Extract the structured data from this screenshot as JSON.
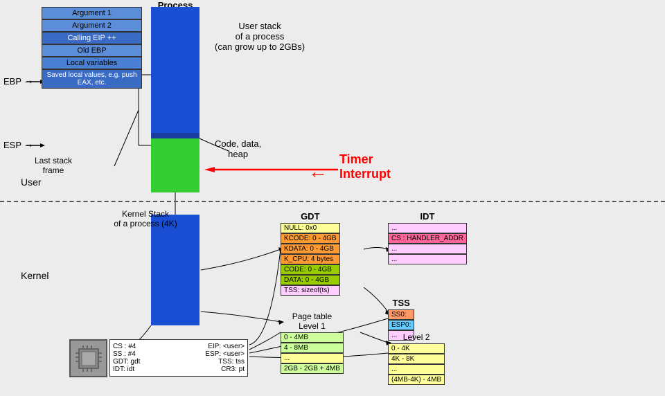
{
  "diagram": {
    "process_label": "Process",
    "user_section_label": "User",
    "kernel_section_label": "Kernel",
    "stack_items": [
      {
        "label": "Argument 1",
        "type": "normal"
      },
      {
        "label": "Argument 2",
        "type": "normal"
      },
      {
        "label": "Calling EIP ++",
        "type": "highlight"
      },
      {
        "label": "Old EBP",
        "type": "normal"
      },
      {
        "label": "Local variables",
        "type": "local"
      },
      {
        "label": "Saved local values, e.g. push EAX, etc.",
        "type": "saved"
      }
    ],
    "ebp_label": "EBP",
    "esp_label": "ESP",
    "user_stack_title": "User stack",
    "user_stack_subtitle": "of a process",
    "user_stack_capacity": "(can grow up to 2GBs)",
    "code_data_label": "Code, data,",
    "code_data_heap": "heap",
    "last_stack_label": "Last stack",
    "last_stack_frame": "frame",
    "timer_interrupt_label": "Timer",
    "timer_interrupt_label2": "Interrupt",
    "kernel_stack_title": "Kernel Stack",
    "kernel_stack_subtitle": "of a process (4K)",
    "gdt": {
      "title": "GDT",
      "rows": [
        {
          "label": "NULL: 0x0",
          "color": "#ffff99"
        },
        {
          "label": "KCODE: 0 - 4GB",
          "color": "#ff9933"
        },
        {
          "label": "KDATA: 0 - 4GB",
          "color": "#ff9933"
        },
        {
          "label": "K_CPU: 4 bytes",
          "color": "#ff9933"
        },
        {
          "label": "CODE: 0 - 4GB",
          "color": "#99cc00"
        },
        {
          "label": "DATA: 0 - 4GB",
          "color": "#99cc00"
        },
        {
          "label": "TSS: sizeof(ts)",
          "color": "#ffccff"
        }
      ]
    },
    "idt": {
      "title": "IDT",
      "rows": [
        {
          "label": "...",
          "color": "#ffccff"
        },
        {
          "label": "CS : HANDLER_ADDR",
          "color": "#ff6699"
        },
        {
          "label": "...",
          "color": "#ffccff"
        },
        {
          "label": "...",
          "color": "#ffccff"
        }
      ]
    },
    "tss": {
      "title": "TSS",
      "rows": [
        {
          "label": "SS0:",
          "color": "#ff9966"
        },
        {
          "label": "ESP0:",
          "color": "#66ccff"
        },
        {
          "label": "...",
          "color": "#ffccff"
        }
      ]
    },
    "pagetable1": {
      "title": "Page table",
      "subtitle": "Level 1",
      "rows": [
        {
          "label": "0 - 4MB",
          "color": "#ccff99"
        },
        {
          "label": "4 - 8MB",
          "color": "#ccff99"
        },
        {
          "label": "...",
          "color": "#ffff99"
        },
        {
          "label": "2GB - 2GB + 4MB",
          "color": "#ccff99"
        }
      ]
    },
    "pagetable2": {
      "title": "",
      "subtitle": "Level 2",
      "rows": [
        {
          "label": "0 - 4K",
          "color": "#ffff99"
        },
        {
          "label": "4K - 8K",
          "color": "#ffff99"
        },
        {
          "label": "...",
          "color": "#ffff99"
        },
        {
          "label": "(4MB-4K) - 4MB",
          "color": "#ffff99"
        }
      ]
    },
    "registers": {
      "cs": "CS : #4",
      "ss": "SS : #4",
      "gdt": "GDT: gdt",
      "idt": "IDT: idt",
      "eip": "EIP: <user>",
      "esp": "ESP: <user>",
      "tss": "TSS: tss",
      "cr3": "CR3: pt"
    }
  }
}
